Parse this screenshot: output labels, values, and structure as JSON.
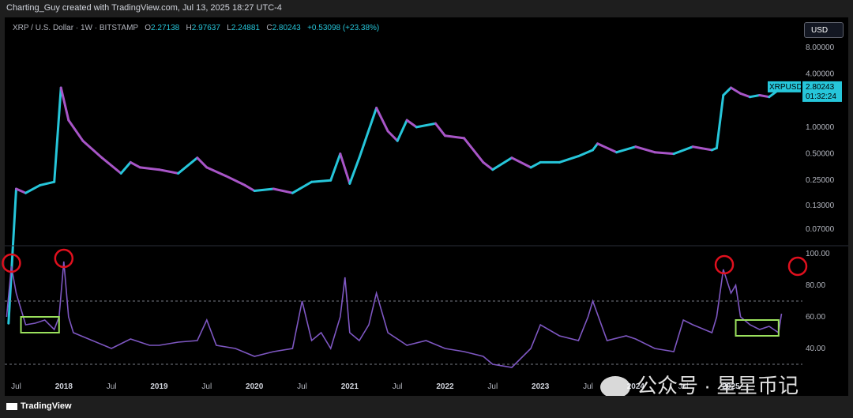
{
  "header": {
    "credit": "Charting_Guy created with TradingView.com, Jul 13, 2025 18:27 UTC-4",
    "symbol_name": "XRP / U.S. Dollar · 1W · BITSTAMP",
    "ohlc": [
      {
        "k": "O",
        "v": "2.27138"
      },
      {
        "k": "H",
        "v": "2.97637"
      },
      {
        "k": "L",
        "v": "2.24881"
      },
      {
        "k": "C",
        "v": "2.80243"
      }
    ],
    "change": "+0.53098 (+23.38%)",
    "currency_button": "USD"
  },
  "footer": {
    "brand": "TradingView",
    "watermark": "公众号 · 星星币记"
  },
  "colors": {
    "bull": "#26c6da",
    "bear": "#a855c7",
    "indicator": "#7e57c2",
    "circle": "#e0101e",
    "box": "#9be15d",
    "tag": "#26c6da"
  },
  "chart_data": [
    {
      "type": "line",
      "title": "XRP / U.S. Dollar · 1W · BITSTAMP",
      "scale": "log",
      "price_axis_ticks": [
        "8.00000",
        "4.00000",
        "1.00000",
        "0.50000",
        "0.25000",
        "0.13000",
        "0.07000"
      ],
      "price_tag": {
        "label": "XRPUSD",
        "value": "2.80243",
        "countdown": "01:32:24"
      },
      "series": [
        {
          "x": [
            2017.42,
            2017.5,
            2017.6,
            2017.75,
            2017.9,
            2017.97,
            2018.05,
            2018.2,
            2018.4,
            2018.6,
            2018.7,
            2018.8,
            2019.0,
            2019.2,
            2019.4,
            2019.5,
            2019.7,
            2019.9,
            2020.0,
            2020.2,
            2020.4,
            2020.6,
            2020.8,
            2020.9,
            2021.0,
            2021.1,
            2021.28,
            2021.4,
            2021.5,
            2021.6,
            2021.7,
            2021.9,
            2022.0,
            2022.2,
            2022.4,
            2022.5,
            2022.7,
            2022.9,
            2023.0,
            2023.2,
            2023.4,
            2023.55,
            2023.6,
            2023.8,
            2024.0,
            2024.2,
            2024.4,
            2024.6,
            2024.8,
            2024.85,
            2024.92,
            2025.0,
            2025.1,
            2025.2,
            2025.3,
            2025.4,
            2025.53
          ],
          "values": [
            0.006,
            0.2,
            0.18,
            0.22,
            0.24,
            2.8,
            1.2,
            0.7,
            0.45,
            0.3,
            0.4,
            0.35,
            0.33,
            0.3,
            0.45,
            0.35,
            0.28,
            0.22,
            0.19,
            0.2,
            0.18,
            0.24,
            0.25,
            0.5,
            0.23,
            0.45,
            1.65,
            0.9,
            0.7,
            1.2,
            1.0,
            1.1,
            0.8,
            0.75,
            0.4,
            0.33,
            0.45,
            0.35,
            0.4,
            0.4,
            0.47,
            0.55,
            0.65,
            0.52,
            0.6,
            0.52,
            0.5,
            0.6,
            0.55,
            0.58,
            2.3,
            2.8,
            2.4,
            2.2,
            2.3,
            2.2,
            2.8
          ]
        }
      ]
    },
    {
      "type": "line",
      "scale": "linear",
      "ylim": [
        25,
        100
      ],
      "y_axis_ticks": [
        "100.00",
        "80.00",
        "60.00",
        "40.00"
      ],
      "reference_lines": [
        70,
        30
      ],
      "series": [
        {
          "x": [
            2017.4,
            2017.45,
            2017.5,
            2017.55,
            2017.6,
            2017.7,
            2017.8,
            2017.9,
            2017.95,
            2018.0,
            2018.05,
            2018.1,
            2018.3,
            2018.5,
            2018.7,
            2018.9,
            2019.0,
            2019.2,
            2019.4,
            2019.5,
            2019.6,
            2019.8,
            2020.0,
            2020.2,
            2020.4,
            2020.5,
            2020.6,
            2020.7,
            2020.8,
            2020.9,
            2020.95,
            2021.0,
            2021.1,
            2021.2,
            2021.28,
            2021.4,
            2021.6,
            2021.8,
            2022.0,
            2022.2,
            2022.4,
            2022.5,
            2022.7,
            2022.9,
            2023.0,
            2023.2,
            2023.4,
            2023.5,
            2023.55,
            2023.7,
            2023.9,
            2024.0,
            2024.2,
            2024.4,
            2024.5,
            2024.6,
            2024.8,
            2024.85,
            2024.92,
            2025.0,
            2025.05,
            2025.1,
            2025.2,
            2025.3,
            2025.4,
            2025.5,
            2025.53
          ],
          "values": [
            60,
            92,
            75,
            65,
            55,
            56,
            58,
            52,
            60,
            95,
            60,
            50,
            45,
            40,
            46,
            42,
            42,
            44,
            45,
            58,
            42,
            40,
            35,
            38,
            40,
            70,
            45,
            50,
            40,
            60,
            85,
            50,
            45,
            55,
            75,
            50,
            42,
            45,
            40,
            38,
            35,
            30,
            28,
            40,
            55,
            48,
            45,
            60,
            70,
            45,
            48,
            46,
            40,
            38,
            58,
            55,
            50,
            60,
            90,
            75,
            80,
            60,
            55,
            52,
            54,
            50,
            62
          ]
        }
      ]
    }
  ],
  "time_axis_ticks": [
    "Jul",
    "2018",
    "Jul",
    "2019",
    "Jul",
    "2020",
    "Jul",
    "2021",
    "Jul",
    "2022",
    "Jul",
    "2023",
    "Jul",
    "2024",
    "Jul",
    "2025"
  ],
  "annotations": {
    "circles": 5,
    "boxes": 2
  }
}
